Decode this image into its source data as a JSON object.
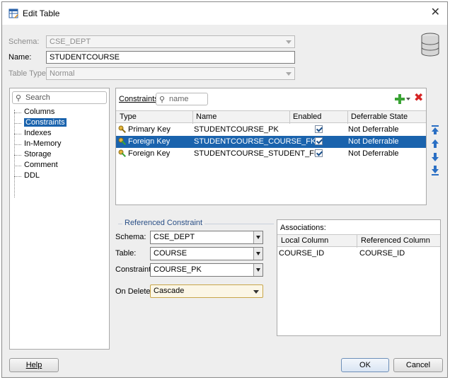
{
  "window": {
    "title": "Edit Table"
  },
  "form": {
    "schema_label": "Schema:",
    "schema_value": "CSE_DEPT",
    "name_label": "Name:",
    "name_value": "STUDENTCOURSE",
    "table_type_label": "Table Type:",
    "table_type_value": "Normal"
  },
  "nav": {
    "search_placeholder": "Search",
    "items": [
      "Columns",
      "Constraints",
      "Indexes",
      "In-Memory",
      "Storage",
      "Comment",
      "DDL"
    ],
    "selected": "Constraints"
  },
  "constraints": {
    "label": "Constraints:",
    "search_placeholder": "name",
    "columns": [
      "Type",
      "Name",
      "Enabled",
      "Deferrable State"
    ],
    "rows": [
      {
        "type": "Primary Key",
        "name": "STUDENTCOURSE_PK",
        "enabled": true,
        "deferrable": "Not Deferrable",
        "selected": false
      },
      {
        "type": "Foreign Key",
        "name": "STUDENTCOURSE_COURSE_FK",
        "enabled": true,
        "deferrable": "Not Deferrable",
        "selected": true
      },
      {
        "type": "Foreign Key",
        "name": "STUDENTCOURSE_STUDENT_FK",
        "enabled": true,
        "deferrable": "Not Deferrable",
        "selected": false
      }
    ]
  },
  "referenced": {
    "title": "Referenced Constraint",
    "schema_label": "Schema:",
    "schema_value": "CSE_DEPT",
    "table_label": "Table:",
    "table_value": "COURSE",
    "constraint_label": "Constraint:",
    "constraint_value": "COURSE_PK",
    "on_delete_label": "On Delete:",
    "on_delete_value": "Cascade"
  },
  "associations": {
    "title": "Associations:",
    "columns": [
      "Local Column",
      "Referenced Column"
    ],
    "rows": [
      {
        "local": "COURSE_ID",
        "referenced": "COURSE_ID"
      }
    ]
  },
  "buttons": {
    "help": "Help",
    "ok": "OK",
    "cancel": "Cancel"
  },
  "icons": {
    "title": "edit-table-icon",
    "database": "database-icon",
    "add": "add-icon",
    "delete": "delete-icon"
  },
  "colors": {
    "selection": "#1a63ad",
    "accent_title": "#2a4f86",
    "delete": "#d62424",
    "add": "#3aa335"
  }
}
